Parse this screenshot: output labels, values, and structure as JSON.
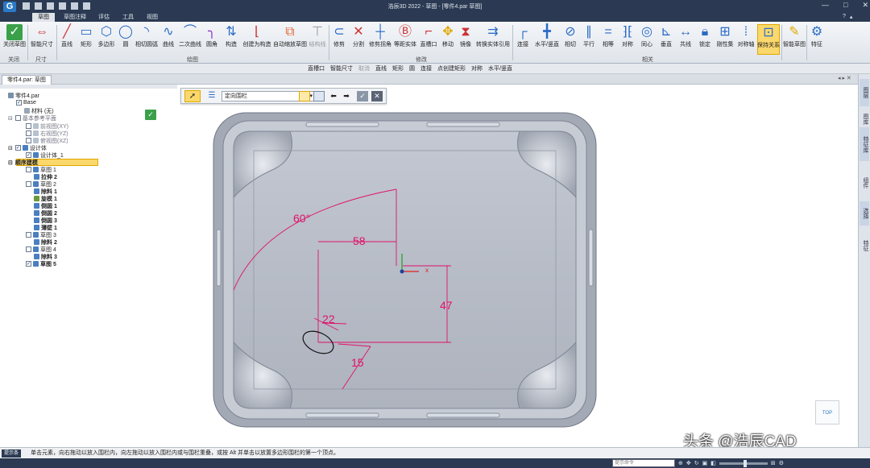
{
  "title": "浩辰3D 2022 - 草图 - [零件4.par 草图]",
  "menu": [
    "草图",
    "草图注释",
    "评估",
    "工具",
    "视图"
  ],
  "tools": [
    {
      "label": "关闭草图",
      "icon": "check-icon"
    },
    {
      "label": "智能尺寸",
      "icon": "smart-dimension-icon"
    },
    {
      "label": "直线",
      "icon": "line-icon"
    },
    {
      "label": "矩形",
      "icon": "rectangle-icon"
    },
    {
      "label": "多边形",
      "icon": "polygon-icon"
    },
    {
      "label": "圆",
      "icon": "circle-icon"
    },
    {
      "label": "相切圆弧",
      "icon": "tangent-arc-icon"
    },
    {
      "label": "曲线",
      "icon": "curve-icon"
    },
    {
      "label": "二次曲线",
      "icon": "conic-icon"
    },
    {
      "label": "圆角",
      "icon": "fillet-icon"
    },
    {
      "label": "构造",
      "icon": "construction-icon"
    },
    {
      "label": "创建为构造",
      "icon": "make-construction-icon"
    },
    {
      "label": "自动缩放草图",
      "icon": "auto-scale-icon"
    },
    {
      "label": "结构线",
      "icon": "structure-line-icon"
    },
    {
      "label": "修剪",
      "icon": "trim-icon"
    },
    {
      "label": "分割",
      "icon": "split-icon"
    },
    {
      "label": "修剪拐角",
      "icon": "trim-corner-icon"
    },
    {
      "label": "等距实体",
      "icon": "offset-icon"
    },
    {
      "label": "直槽口",
      "icon": "slot-icon"
    },
    {
      "label": "移动",
      "icon": "move-icon"
    },
    {
      "label": "镜像",
      "icon": "mirror-icon"
    },
    {
      "label": "转换实体引用",
      "icon": "convert-entities-icon"
    },
    {
      "label": "连接",
      "icon": "connect-icon"
    },
    {
      "label": "水平/竖直",
      "icon": "horizontal-vertical-icon"
    },
    {
      "label": "相切",
      "icon": "tangent-icon"
    },
    {
      "label": "平行",
      "icon": "parallel-icon"
    },
    {
      "label": "相等",
      "icon": "equal-icon"
    },
    {
      "label": "对称",
      "icon": "symmetric-icon"
    },
    {
      "label": "同心",
      "icon": "concentric-icon"
    },
    {
      "label": "垂直",
      "icon": "perpendicular-icon"
    },
    {
      "label": "共线",
      "icon": "collinear-icon"
    },
    {
      "label": "锁定",
      "icon": "lock-icon"
    },
    {
      "label": "刚性集",
      "icon": "rigid-set-icon"
    },
    {
      "label": "对称轴",
      "icon": "symmetry-axis-icon"
    },
    {
      "label": "保持关系",
      "icon": "keep-relations-icon"
    },
    {
      "label": "智能草图",
      "icon": "smart-sketch-icon"
    },
    {
      "label": "特征",
      "icon": "feature-icon"
    }
  ],
  "groups": [
    "关闭",
    "尺寸",
    "绘图",
    "修改",
    "相关"
  ],
  "strip": [
    "直槽口",
    "智能尺寸",
    "取消",
    "直线",
    "矩形",
    "圆",
    "连接",
    "点创建矩形",
    "对称",
    "水平/竖直"
  ],
  "tab": "零件4.par: 草图",
  "tree": [
    "零件4.par",
    "Base",
    "材料 (无)",
    "基本参考平面",
    "前视图(XY)",
    "右视图(YZ)",
    "俯视图(XZ)",
    "设计体",
    "设计体_1",
    "顺序建模",
    "草图 1",
    "拉伸 2",
    "草图 2",
    "除料 1",
    "旋模 1",
    "倒圆 1",
    "倒圆 2",
    "倒圆 3",
    "薄壁 1",
    "草图 3",
    "除料 2",
    "草图 4",
    "除料 3",
    "草图 5"
  ],
  "combo": "定向围栏",
  "dims": {
    "angle": "60°",
    "d58": "58",
    "d47": "47",
    "d22": "22",
    "d15": "15",
    "axis": "x"
  },
  "viewcube": "TOP",
  "rpanel": [
    "图层",
    "图库",
    "特征库",
    "组件",
    "选择",
    "特征"
  ],
  "status": "单击元素，向右拖动以放入围栏内，向左拖动以放入围栏内或与围栏重叠，或按 Alt 并单击以放置多边形围栏的第一个顶点。",
  "status_label": "提示条",
  "cmd_placeholder": "提示命令",
  "watermark": "头条 @浩辰CAD",
  "colors": {
    "dim": "#e0116b",
    "accent": "#f5a623",
    "dark": "#2b3a52"
  }
}
